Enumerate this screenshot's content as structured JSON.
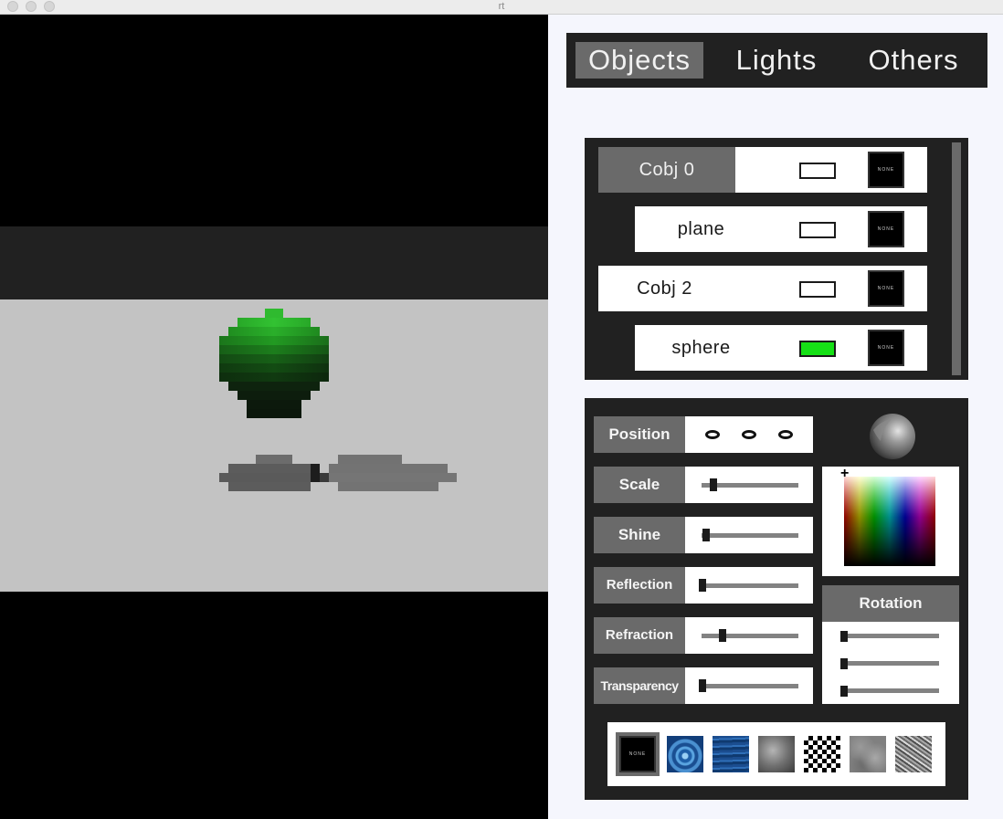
{
  "window": {
    "title": "rt"
  },
  "tabs": [
    {
      "label": "Objects",
      "active": true
    },
    {
      "label": "Lights",
      "active": false
    },
    {
      "label": "Others",
      "active": false
    }
  ],
  "objects": [
    {
      "name": "Cobj 0",
      "selected": true,
      "color": "#ffffff",
      "texture": "NONE"
    },
    {
      "name": "plane",
      "selected": false,
      "color": "#ffffff",
      "texture": "NONE"
    },
    {
      "name": "Cobj 2",
      "selected": false,
      "color": "#ffffff",
      "texture": "NONE"
    },
    {
      "name": "sphere",
      "selected": false,
      "color": "#16e016",
      "texture": "NONE"
    }
  ],
  "properties": {
    "position": {
      "label": "Position",
      "values": [
        "0",
        "0",
        "0"
      ]
    },
    "sliders": [
      {
        "key": "scale",
        "label": "Scale",
        "level": 0.12
      },
      {
        "key": "shine",
        "label": "Shine",
        "level": 0.04
      },
      {
        "key": "reflection",
        "label": "Reflection",
        "level": 0.0
      },
      {
        "key": "refraction",
        "label": "Refraction",
        "level": 0.22
      },
      {
        "key": "transparency",
        "label": "Transparency",
        "level": 0.0
      }
    ]
  },
  "rotation": {
    "label": "Rotation",
    "levels": [
      0.0,
      0.0,
      0.0
    ]
  },
  "textures": [
    {
      "name": "none",
      "label": "NONE",
      "selected": true
    },
    {
      "name": "water-ripple",
      "selected": false
    },
    {
      "name": "water-waves",
      "selected": false
    },
    {
      "name": "metal-brushed",
      "selected": false
    },
    {
      "name": "checkerboard",
      "selected": false
    },
    {
      "name": "perlin-noise",
      "selected": false
    },
    {
      "name": "marble-noise",
      "selected": false
    }
  ],
  "colors": {
    "panel_bg": "#f5f6fd",
    "dark": "#212121",
    "label_gray": "#6a6a6a",
    "sphere_green": "#1fa51f"
  }
}
